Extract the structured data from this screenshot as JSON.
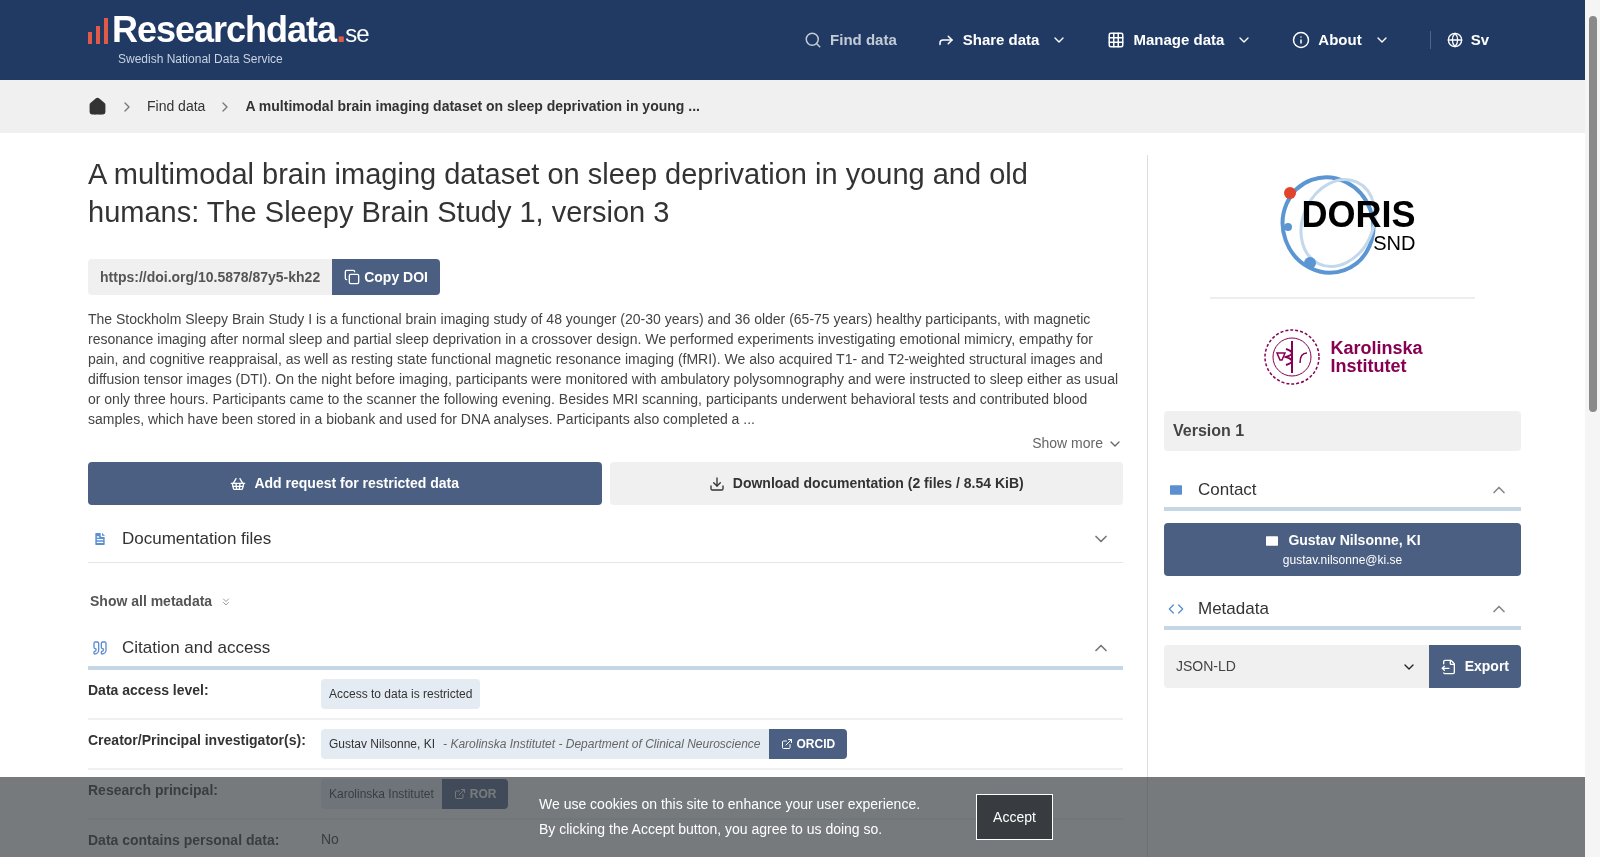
{
  "header": {
    "logo": {
      "name": "Researchdata",
      "dot": ".",
      "tld": "se",
      "tagline": "Swedish National Data Service"
    },
    "nav": [
      {
        "label": "Find data",
        "kind": "search",
        "dropdown": false,
        "selected": true
      },
      {
        "label": "Share data",
        "kind": "share",
        "dropdown": true,
        "selected": false
      },
      {
        "label": "Manage data",
        "kind": "grid",
        "dropdown": true,
        "selected": false
      },
      {
        "label": "About",
        "kind": "info",
        "dropdown": true,
        "selected": false
      }
    ],
    "language": "Sv"
  },
  "breadcrumb": [
    "Find data",
    "A multimodal brain imaging dataset on sleep deprivation in young ..."
  ],
  "title": "A multimodal brain imaging dataset on sleep deprivation in young and old humans: The Sleepy Brain Study 1, version 3",
  "doi": {
    "value": "https://doi.org/10.5878/87y5-kh22",
    "button": "Copy DOI"
  },
  "description": "The Stockholm Sleepy Brain Study I is a functional brain imaging study of 48 younger (20-30 years) and 36 older (65-75 years) healthy participants, with magnetic resonance imaging after normal sleep and partial sleep deprivation in a crossover design. We performed experiments investigating emotional mimicry, empathy for pain, and cognitive reappraisal, as well as resting state functional magnetic resonance imaging (fMRI). We also acquired T1- and T2-weighted structural images and diffusion tensor images (DTI). On the night before imaging, participants were monitored with ambulatory polysomnography and were instructed to sleep either as usual or only three hours. Participants came to the scanner the following evening. Besides MRI scanning, participants underwent behavioral tests and contributed blood samples, which have been stored in a biobank and used for DNA analyses. Participants also completed a ...",
  "show_more": "Show more",
  "actions": [
    {
      "label": "Add request for restricted data",
      "kind": "primary"
    },
    {
      "label": "Download documentation (2 files / 8.54 KiB)",
      "kind": "secondary"
    }
  ],
  "documentation_files": {
    "title": "Documentation files",
    "expanded": false
  },
  "show_all_metadata": "Show all metadata",
  "citation": {
    "title": "Citation and access",
    "expanded": true,
    "rows": [
      {
        "label": "Data access level:",
        "kind": "tag",
        "value": "Access to data is restricted"
      },
      {
        "label": "Creator/Principal investigator(s):",
        "kind": "person",
        "value": "Gustav Nilsonne, KI",
        "affiliation": "- Karolinska Institutet - Department of Clinical Neuroscience",
        "link": "ORCID"
      },
      {
        "label": "Research principal:",
        "kind": "org",
        "value": "Karolinska Institutet",
        "link": "ROR"
      },
      {
        "label": "Data contains personal data:",
        "kind": "plain",
        "value": "No"
      }
    ]
  },
  "sidebar": {
    "doris": {
      "name": "DORIS",
      "sub": "SND"
    },
    "ki": {
      "line1": "Karolinska",
      "line2": "Institutet"
    },
    "version": "Version 1",
    "contact": {
      "title": "Contact",
      "expanded": true,
      "name": "Gustav Nilsonne, KI",
      "email": "gustav.nilsonne@ki.se"
    },
    "metadata": {
      "title": "Metadata",
      "expanded": true,
      "format": "JSON-LD",
      "export": "Export"
    }
  },
  "cookie": {
    "lines": [
      "We use cookies on this site to enhance your user experience.",
      "By clicking the Accept button, you agree to us doing so."
    ],
    "accept": "Accept"
  }
}
